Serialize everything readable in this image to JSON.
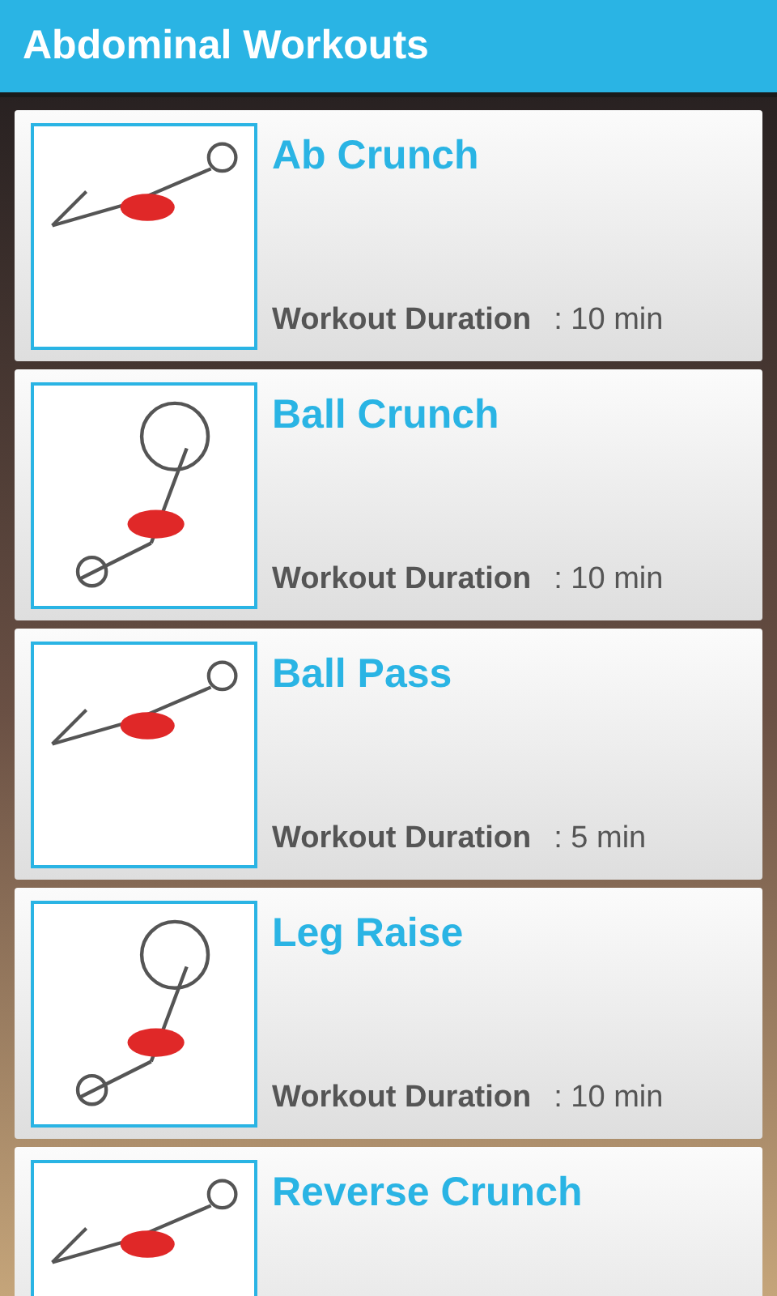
{
  "app_bar": {
    "title": "Abdominal Workouts"
  },
  "workouts": [
    {
      "name": "Ab Crunch",
      "duration_label": "Workout Duration",
      "duration": ": 10 min"
    },
    {
      "name": "Ball Crunch",
      "duration_label": "Workout Duration",
      "duration": ": 10 min"
    },
    {
      "name": "Ball Pass",
      "duration_label": "Workout Duration",
      "duration": ": 5 min"
    },
    {
      "name": "Leg Raise",
      "duration_label": "Workout Duration",
      "duration": ": 10 min"
    },
    {
      "name": "Reverse Crunch"
    }
  ]
}
